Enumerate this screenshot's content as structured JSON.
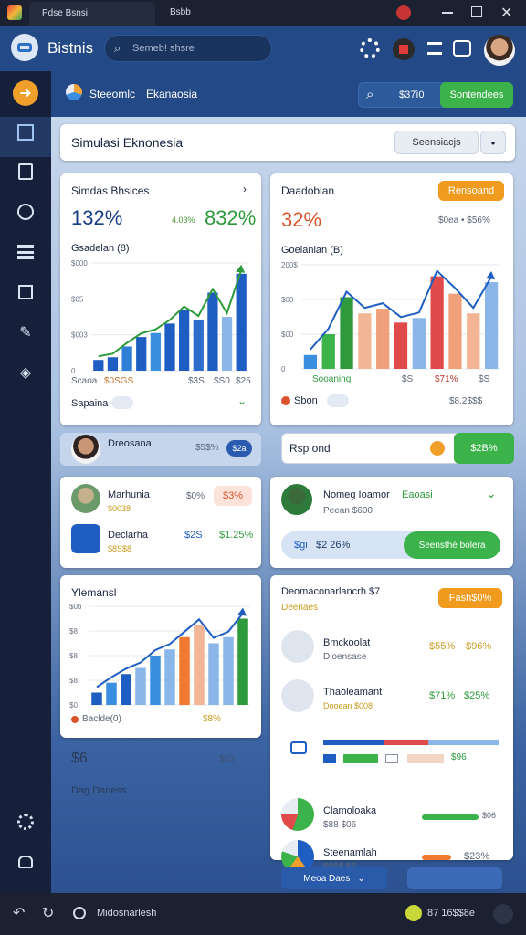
{
  "titlebar": {
    "tab_title": "Pdse Bsnsi",
    "app_title": "Bsbb"
  },
  "header": {
    "app_name": "Bistnis",
    "search_placeholder": "Semeb! shsre"
  },
  "subheader": {
    "tab1": "Steeomlc",
    "tab2": "Ekanaosia",
    "price": "$37ì0",
    "cta": "Sontendees"
  },
  "toolbar": {
    "title": "Simulasi Eknonesia",
    "search_button": "Seensiacjs"
  },
  "card1": {
    "title": "Simdas Bhsices",
    "big_value": "132%",
    "sub_value": "4.03%",
    "green_value": "832%",
    "chart_label": "Gsadelan (8)",
    "yticks": [
      "$000",
      "$05",
      "$003",
      "0"
    ],
    "xlabels": [
      "Scaoa",
      "$0SGS",
      "$3S",
      "$S0",
      "$25"
    ],
    "footer": "Sapaina"
  },
  "card2": {
    "title": "Daadoblan",
    "badge": "Rensoand",
    "big_value": "32%",
    "side_value": "$0ea • $56%",
    "chart_label": "Goelanlan (B)",
    "yticks": [
      "200$",
      "$00",
      "$00",
      "0"
    ],
    "xlabels": [
      "Sooaning",
      "$S",
      "$71%",
      "$S"
    ],
    "footer": "Sbon",
    "footer_value": "$8.2$$$"
  },
  "row_a": {
    "name": "Dreosana",
    "value": "$5$%",
    "pill": "$2a"
  },
  "row_b": {
    "input_value": "Rsp ond",
    "value": "$2B%"
  },
  "card3": {
    "item1_name": "Marhunia",
    "item1_sub": "$0038",
    "item1_value": "$0%",
    "item1_badge": "$3%",
    "item2_name": "Declarha",
    "item2_sub": "$8S$8",
    "item2_value": "$2S",
    "item2_value2": "$1.25%"
  },
  "card4": {
    "name": "Nomeg Ioamor",
    "tag": "Eaoasi",
    "sub": "Peean $600",
    "progress_label": "$gi",
    "progress_value": "$2 26%",
    "button": "Seensthé bolera",
    "progress": 0.35
  },
  "card5": {
    "title": "Ylemansl",
    "yticks": [
      "$0b",
      "$8",
      "$8",
      "$8",
      "$0"
    ],
    "footer": "Baclde(0)",
    "footer_value": "$8%"
  },
  "card6": {
    "title": "Deomaconarlancrh $7",
    "sub": "Deenaes",
    "badge": "Fash$0%",
    "row1_name": "Bmckoolat",
    "row1_sub": "Dioensase",
    "row1_v1": "$55%",
    "row1_v2": "$96%",
    "row2_name": "Thaoleamant",
    "row2_sub": "Dooean $008",
    "row2_v1": "$71%",
    "row2_v2": "$25%",
    "row3_v1": "$96",
    "row4_name": "Clamoloaka",
    "row4_sub": "$88 $06",
    "row4_value": "$06",
    "row5_name": "Steenamlah",
    "row5_sub": "$0$$ $6",
    "row5_value": "$23%"
  },
  "left_lower": {
    "label1": "$6",
    "label2": "$03",
    "label3": "Dag Daness"
  },
  "footer_buttons": {
    "dropdown": "Meoa Daes"
  },
  "bottombar": {
    "address": "Midosnarlesh",
    "status": "87 16$$8e"
  },
  "chart_data": [
    {
      "type": "bar",
      "title": "",
      "categories": [
        "1",
        "2",
        "3",
        "4",
        "5",
        "6",
        "7",
        "8",
        "9",
        "10",
        "11"
      ],
      "series": [
        {
          "name": "",
          "values": [
            8,
            10,
            18,
            25,
            28,
            35,
            45,
            38,
            58,
            40,
            72
          ]
        }
      ],
      "ylim": [
        0,
        80
      ]
    },
    {
      "type": "bar",
      "title": "",
      "categories": [
        "1",
        "2",
        "3",
        "4",
        "5",
        "6",
        "7",
        "8",
        "9",
        "10",
        "11"
      ],
      "series": [
        {
          "name": "",
          "values": [
            12,
            30,
            62,
            48,
            52,
            40,
            44,
            80,
            65,
            48,
            75
          ]
        }
      ],
      "ylim": [
        0,
        90
      ]
    },
    {
      "type": "bar",
      "title": "",
      "categories": [
        "1",
        "2",
        "3",
        "4",
        "5",
        "6",
        "7",
        "8",
        "9",
        "10",
        "11"
      ],
      "series": [
        {
          "name": "",
          "values": [
            10,
            18,
            25,
            30,
            40,
            45,
            55,
            65,
            50,
            55,
            70
          ]
        }
      ],
      "ylim": [
        0,
        80
      ]
    }
  ]
}
